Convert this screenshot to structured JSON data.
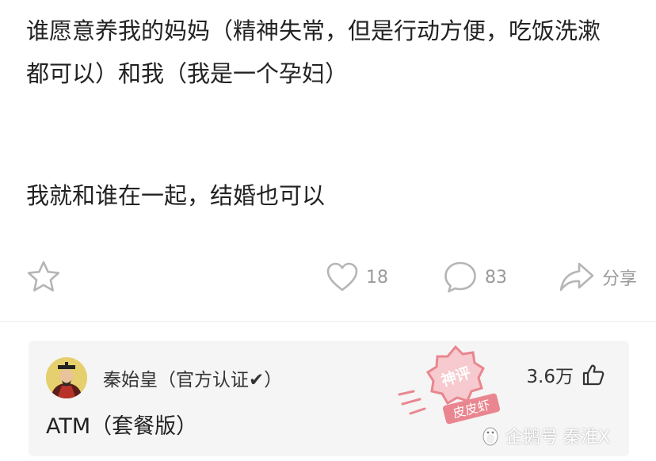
{
  "post": {
    "line1": "谁愿意养我的妈妈（精神失常，但是行动方便，吃饭洗漱",
    "line2": "都可以）和我（我是一个孕妇）",
    "line3": "我就和谁在一起，结婚也可以"
  },
  "actions": {
    "favorite_icon": "star-icon",
    "likes_icon": "heart-icon",
    "likes_count": "18",
    "comments_icon": "comment-bubble-icon",
    "comments_count": "83",
    "share_icon": "share-arrow-icon",
    "share_label": "分享"
  },
  "top_comment": {
    "author": "秦始皇（官方认证✔）",
    "likes_count": "3.6万",
    "text": "ATM（套餐版）"
  },
  "stamp": {
    "line1": "神评",
    "line2": "皮皮虾"
  },
  "watermark": {
    "text": "企鹅号 秦淮X"
  },
  "colors": {
    "icon_gray": "#b5b5b5",
    "count_gray": "#9a9a9a",
    "card_bg": "#f5f5f5",
    "stamp_red": "#e8737e"
  }
}
